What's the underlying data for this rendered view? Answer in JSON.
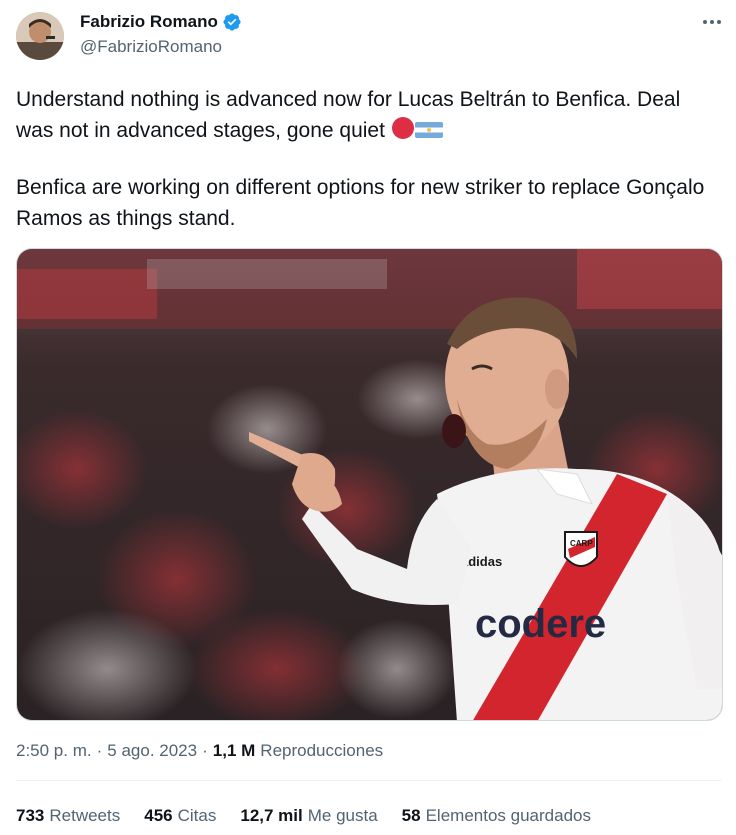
{
  "author": {
    "name": "Fabrizio Romano",
    "handle": "@FabrizioRomano",
    "verified": true,
    "verified_color": "#1d9bf0"
  },
  "tweet": {
    "paragraph1": "Understand nothing is advanced now for Lucas Beltrán to Benfica. Deal was not in advanced stages, gone quiet",
    "paragraph1_emojis": [
      "red-circle-emoji",
      "argentina-flag-emoji"
    ],
    "paragraph2": "Benfica are working on different options for new striker to replace Gonçalo Ramos as things stand."
  },
  "media": {
    "shirt_sponsor": "codere"
  },
  "meta": {
    "time": "2:50 p. m.",
    "separator": "·",
    "date": "5 ago. 2023",
    "views_count": "1,1 M",
    "views_label": "Reproducciones"
  },
  "stats": [
    {
      "count": "733",
      "label": "Retweets"
    },
    {
      "count": "456",
      "label": "Citas"
    },
    {
      "count": "12,7 mil",
      "label": "Me gusta"
    },
    {
      "count": "58",
      "label": "Elementos guardados"
    }
  ],
  "colors": {
    "text": "#0f1419",
    "secondary": "#536471",
    "divider": "#eff3f4"
  }
}
